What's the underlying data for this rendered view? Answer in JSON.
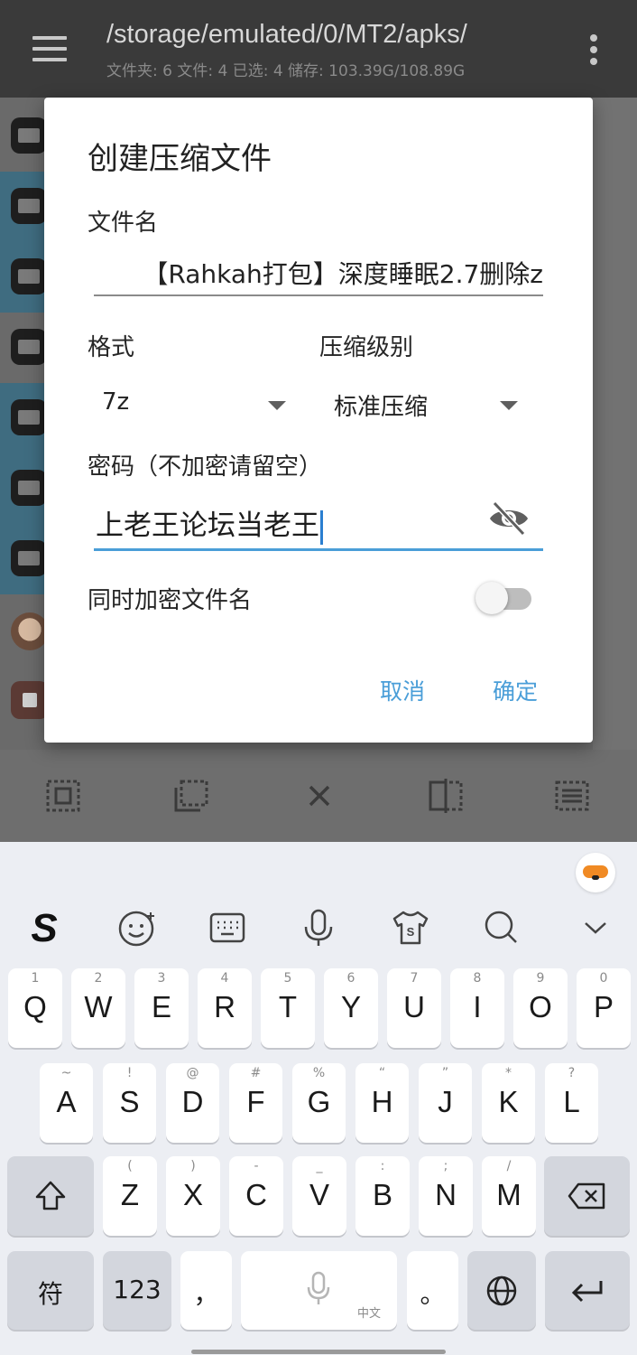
{
  "appbar": {
    "path": "/storage/emulated/0/MT2/apks/",
    "stats": "文件夹: 6  文件: 4  已选: 4  储存: 103.39G/108.89G"
  },
  "dialog": {
    "title": "创建压缩文件",
    "filename_label": "文件名",
    "filename_value": "【Rahkah打包】深度睡眠2.7删除z",
    "format_label": "格式",
    "format_value": "7z",
    "level_label": "压缩级别",
    "level_value": "标准压缩",
    "password_label": "密码（不加密请留空）",
    "password_value": "上老王论坛当老王",
    "encrypt_names_label": "同时加密文件名",
    "encrypt_names_on": false,
    "cancel": "取消",
    "confirm": "确定"
  },
  "keyboard": {
    "row1": [
      {
        "key": "Q",
        "hint": "1"
      },
      {
        "key": "W",
        "hint": "2"
      },
      {
        "key": "E",
        "hint": "3"
      },
      {
        "key": "R",
        "hint": "4"
      },
      {
        "key": "T",
        "hint": "5"
      },
      {
        "key": "Y",
        "hint": "6"
      },
      {
        "key": "U",
        "hint": "7"
      },
      {
        "key": "I",
        "hint": "8"
      },
      {
        "key": "O",
        "hint": "9"
      },
      {
        "key": "P",
        "hint": "0"
      }
    ],
    "row2": [
      {
        "key": "A",
        "hint": "~"
      },
      {
        "key": "S",
        "hint": "!"
      },
      {
        "key": "D",
        "hint": "@"
      },
      {
        "key": "F",
        "hint": "#"
      },
      {
        "key": "G",
        "hint": "%"
      },
      {
        "key": "H",
        "hint": "“"
      },
      {
        "key": "J",
        "hint": "”"
      },
      {
        "key": "K",
        "hint": "*"
      },
      {
        "key": "L",
        "hint": "?"
      }
    ],
    "row3": [
      {
        "key": "Z",
        "hint": "("
      },
      {
        "key": "X",
        "hint": ")"
      },
      {
        "key": "C",
        "hint": "-"
      },
      {
        "key": "V",
        "hint": "_"
      },
      {
        "key": "B",
        "hint": ":"
      },
      {
        "key": "N",
        "hint": ";"
      },
      {
        "key": "M",
        "hint": "/"
      }
    ],
    "symbols": "符",
    "numbers": "123",
    "comma": "，",
    "period": "。",
    "space_sub": "中文"
  },
  "colors": {
    "accent": "#4a9ed8",
    "appbar": "#3a3a3a",
    "keyboard_bg": "#eceef3"
  }
}
